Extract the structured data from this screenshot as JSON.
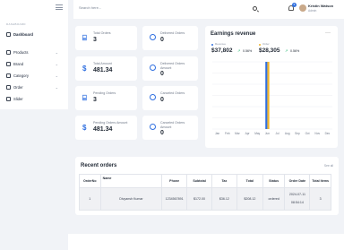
{
  "sidebar": {
    "section_label": "DASHBOARD",
    "items": [
      {
        "label": "Dashboard",
        "icon": "grid-icon",
        "bold": true
      },
      {
        "label": "Products",
        "icon": "cart-icon"
      },
      {
        "label": "Brand",
        "icon": "tag-icon"
      },
      {
        "label": "Category",
        "icon": "layers-icon"
      },
      {
        "label": "Order",
        "icon": "cart-icon"
      },
      {
        "label": "Slider",
        "icon": "image-icon"
      }
    ]
  },
  "header": {
    "search_placeholder": "Search here...",
    "notification_count": "5",
    "user_name": "Kristin Watson",
    "user_role": "Admin"
  },
  "stats": [
    {
      "label": "Total Orders",
      "value": "3"
    },
    {
      "label": "Total Amount",
      "value": "481.34"
    },
    {
      "label": "Pending Orders",
      "value": "3"
    },
    {
      "label": "Pending Orders Amount",
      "value": "481.34"
    },
    {
      "label": "Delivered Orders",
      "value": "0"
    },
    {
      "label": "Delivered Orders Amount",
      "value": "0"
    },
    {
      "label": "Canceled Orders",
      "value": "0"
    },
    {
      "label": "Canceled Orders Amount",
      "value": "0"
    }
  ],
  "earnings": {
    "title": "Earnings revenue",
    "revenue_label": "Revenue",
    "revenue_value": "$37,802",
    "revenue_pct": "0.56%",
    "order_label": "Order",
    "order_value": "$28,305",
    "order_pct": "0.56%",
    "colors": {
      "revenue": "#2f6fe0",
      "order": "#f0b429"
    }
  },
  "chart_data": {
    "type": "bar",
    "categories": [
      "Jan",
      "Feb",
      "Mar",
      "Apr",
      "May",
      "Jun",
      "Jul",
      "Aug",
      "Sep",
      "Oct",
      "Nov",
      "Dec"
    ],
    "series": [
      {
        "name": "Revenue",
        "values": [
          0,
          0,
          0,
          0,
          0,
          100,
          0,
          0,
          0,
          0,
          0,
          0
        ]
      },
      {
        "name": "Order",
        "values": [
          0,
          0,
          0,
          0,
          0,
          100,
          0,
          0,
          0,
          0,
          0,
          0
        ]
      }
    ],
    "ylim": [
      0,
      100
    ],
    "grid": true
  },
  "orders": {
    "title": "Recent orders",
    "see_all": "See all",
    "columns": [
      "OrderNo",
      "Name",
      "Phone",
      "Subtotal",
      "Tax",
      "Total",
      "Status",
      "Order Date",
      "Total Items"
    ],
    "rows": [
      [
        "1",
        "Divyansh Kumar",
        "1234567891",
        "$172.00",
        "$36.12",
        "$208.12",
        "ordered",
        "2024-07-11 08:54:14",
        "3"
      ]
    ]
  }
}
